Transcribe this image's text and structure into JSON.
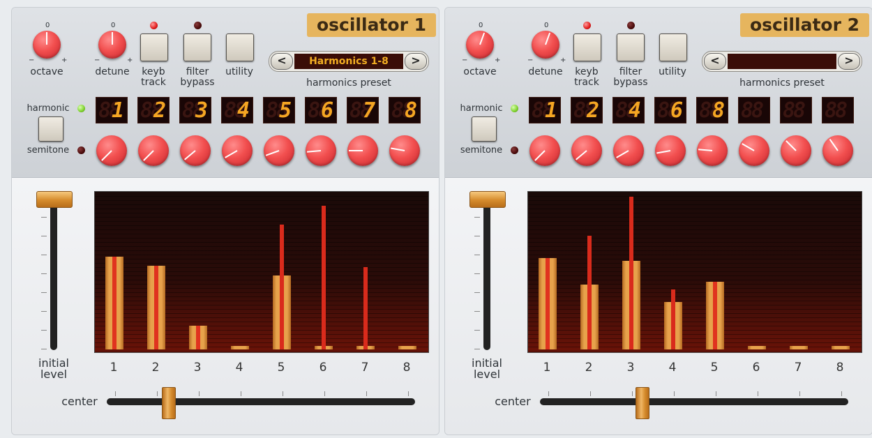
{
  "oscillators": [
    {
      "title": "oscillator 1",
      "octave_label": "octave",
      "octave_zero": "0",
      "octave_minus": "−",
      "octave_plus": "+",
      "detune_label": "detune",
      "detune_zero": "0",
      "detune_minus": "−",
      "detune_plus": "+",
      "keyb_track_label_1": "keyb",
      "keyb_track_label_2": "track",
      "filter_bypass_label_1": "filter",
      "filter_bypass_label_2": "bypass",
      "utility_label": "utility",
      "preset_prev": "<",
      "preset_next": ">",
      "preset_value": "Harmonics 1-8",
      "preset_label": "harmonics preset",
      "harmonic_label": "harmonic",
      "semitone_label": "semitone",
      "displays": [
        "1",
        "2",
        "3",
        "4",
        "5",
        "6",
        "7",
        "8"
      ],
      "knob_angles": [
        225,
        225,
        230,
        240,
        250,
        265,
        270,
        280
      ],
      "initial_level_label_1": "initial",
      "initial_level_label_2": "level",
      "center_label": "center",
      "center_value": 0.2,
      "initial_level_value": 1.0,
      "harmonic_numbers": [
        "1",
        "2",
        "3",
        "4",
        "5",
        "6",
        "7",
        "8"
      ],
      "bar_levels": [
        0.59,
        0.53,
        0.15,
        0.02,
        0.47,
        0.02,
        0.02,
        0.02
      ],
      "stick_levels": [
        0,
        0,
        0,
        0,
        0.79,
        0.91,
        0.52,
        0
      ]
    },
    {
      "title": "oscillator 2",
      "octave_label": "octave",
      "octave_zero": "0",
      "octave_minus": "−",
      "octave_plus": "+",
      "detune_label": "detune",
      "detune_zero": "0",
      "detune_minus": "−",
      "detune_plus": "+",
      "keyb_track_label_1": "keyb",
      "keyb_track_label_2": "track",
      "filter_bypass_label_1": "filter",
      "filter_bypass_label_2": "bypass",
      "utility_label": "utility",
      "preset_prev": "<",
      "preset_next": ">",
      "preset_value": "",
      "preset_label": "harmonics preset",
      "harmonic_label": "harmonic",
      "semitone_label": "semitone",
      "displays": [
        "1",
        "2",
        "4",
        "6",
        "8",
        "",
        "",
        ""
      ],
      "knob_angles": [
        225,
        230,
        240,
        260,
        275,
        300,
        315,
        325
      ],
      "initial_level_label_1": "initial",
      "initial_level_label_2": "level",
      "center_label": "center",
      "center_value": 0.33,
      "initial_level_value": 1.0,
      "harmonic_numbers": [
        "1",
        "2",
        "3",
        "4",
        "5",
        "6",
        "7",
        "8"
      ],
      "bar_levels": [
        0.58,
        0.41,
        0.56,
        0.3,
        0.43,
        0.02,
        0.02,
        0.02
      ],
      "stick_levels": [
        0,
        0.72,
        0.97,
        0.38,
        0,
        0,
        0,
        0
      ]
    }
  ]
}
